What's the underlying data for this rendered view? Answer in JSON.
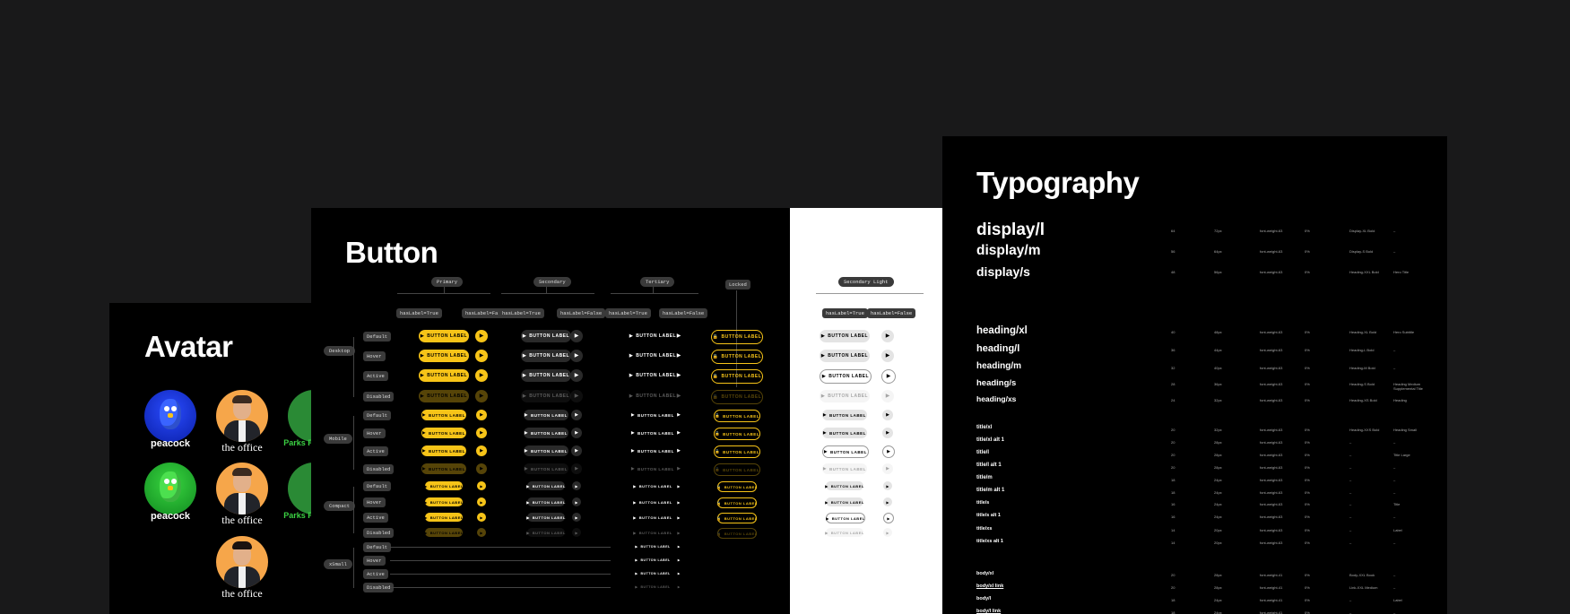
{
  "avatar": {
    "title": "Avatar",
    "captions": [
      "peacock",
      "the office",
      "the office",
      "peacock",
      "the office",
      "the office",
      "Parks Rec",
      "Parks Rec"
    ]
  },
  "button": {
    "title": "Button",
    "variants": [
      "Primary",
      "Secondary",
      "Tertiary",
      "Locked"
    ],
    "label_true": "hasLabel=True",
    "label_false": "hasLabel=False",
    "sizes": [
      "Desktop",
      "Mobile",
      "Compact",
      "xSmall"
    ],
    "states": [
      "Default",
      "Hover",
      "Active",
      "Disabled"
    ],
    "button_label": "BUTTON LABEL",
    "button_label_short": "BUTTON LABEL",
    "secondary_light": "Secondary Light"
  },
  "typography": {
    "title": "Typography",
    "rows": [
      {
        "name": "display/l",
        "size": "64",
        "lh": "72px",
        "weight": "font-weight-63",
        "ls": "0%",
        "font": "Display-XL Bold",
        "note": "–"
      },
      {
        "name": "display/m",
        "size": "56",
        "lh": "64px",
        "weight": "font-weight-63",
        "ls": "0%",
        "font": "Display-S Bold",
        "note": "–"
      },
      {
        "name": "display/s",
        "size": "48",
        "lh": "56px",
        "weight": "font-weight-63",
        "ls": "0%",
        "font": "Heading-XXL Bold",
        "note": "Hero Title"
      },
      {
        "name": "heading/xl",
        "size": "40",
        "lh": "48px",
        "weight": "font-weight-63",
        "ls": "0%",
        "font": "Heading-XL Bold",
        "note": "Hero Subtitle"
      },
      {
        "name": "heading/l",
        "size": "36",
        "lh": "44px",
        "weight": "font-weight-63",
        "ls": "0%",
        "font": "Heading-L Bold",
        "note": "–"
      },
      {
        "name": "heading/m",
        "size": "32",
        "lh": "40px",
        "weight": "font-weight-63",
        "ls": "0%",
        "font": "Heading-M Bold",
        "note": "–"
      },
      {
        "name": "heading/s",
        "size": "28",
        "lh": "36px",
        "weight": "font-weight-63",
        "ls": "0%",
        "font": "Heading-S Bold",
        "note": "Heading Medium Supplemental Title"
      },
      {
        "name": "heading/xs",
        "size": "24",
        "lh": "32px",
        "weight": "font-weight-63",
        "ls": "0%",
        "font": "Heading-XS Bold",
        "note": "Heading"
      },
      {
        "name": "title/xl",
        "size": "20",
        "lh": "32px",
        "weight": "font-weight-63",
        "ls": "0%",
        "font": "Heading-XXS Bold",
        "note": "Heading Small"
      },
      {
        "name": "title/xl alt 1",
        "size": "20",
        "lh": "28px",
        "weight": "font-weight-63",
        "ls": "0%",
        "font": "–",
        "note": "–"
      },
      {
        "name": "title/l",
        "size": "20",
        "lh": "28px",
        "weight": "font-weight-63",
        "ls": "0%",
        "font": "–",
        "note": "Title Large"
      },
      {
        "name": "title/l alt 1",
        "size": "20",
        "lh": "28px",
        "weight": "font-weight-63",
        "ls": "0%",
        "font": "–",
        "note": "–"
      },
      {
        "name": "title/m",
        "size": "18",
        "lh": "24px",
        "weight": "font-weight-63",
        "ls": "0%",
        "font": "–",
        "note": "–"
      },
      {
        "name": "title/m alt 1",
        "size": "18",
        "lh": "24px",
        "weight": "font-weight-63",
        "ls": "0%",
        "font": "–",
        "note": "–"
      },
      {
        "name": "title/s",
        "size": "16",
        "lh": "24px",
        "weight": "font-weight-63",
        "ls": "0%",
        "font": "–",
        "note": "Title"
      },
      {
        "name": "title/s alt 1",
        "size": "16",
        "lh": "24px",
        "weight": "font-weight-63",
        "ls": "0%",
        "font": "–",
        "note": "–"
      },
      {
        "name": "title/xs",
        "size": "14",
        "lh": "20px",
        "weight": "font-weight-63",
        "ls": "0%",
        "font": "–",
        "note": "Label"
      },
      {
        "name": "title/xs alt 1",
        "size": "14",
        "lh": "20px",
        "weight": "font-weight-63",
        "ls": "0%",
        "font": "–",
        "note": "–"
      },
      {
        "name": "body/xl",
        "size": "20",
        "lh": "28px",
        "weight": "font-weight-41",
        "ls": "0%",
        "font": "Body-XXL Book",
        "note": "–"
      },
      {
        "name": "body/xl link",
        "size": "20",
        "lh": "28px",
        "weight": "font-weight-41",
        "ls": "0%",
        "font": "Link-XXL Medium",
        "note": "–"
      },
      {
        "name": "body/l",
        "size": "18",
        "lh": "24px",
        "weight": "font-weight-41",
        "ls": "0%",
        "font": "–",
        "note": "Label"
      },
      {
        "name": "body/l link",
        "size": "18",
        "lh": "24px",
        "weight": "font-weight-41",
        "ls": "0%",
        "font": "–",
        "note": "–"
      }
    ]
  },
  "colors": {
    "bg": "#19191a",
    "panel": "#000000",
    "primary": "#f7c418"
  }
}
